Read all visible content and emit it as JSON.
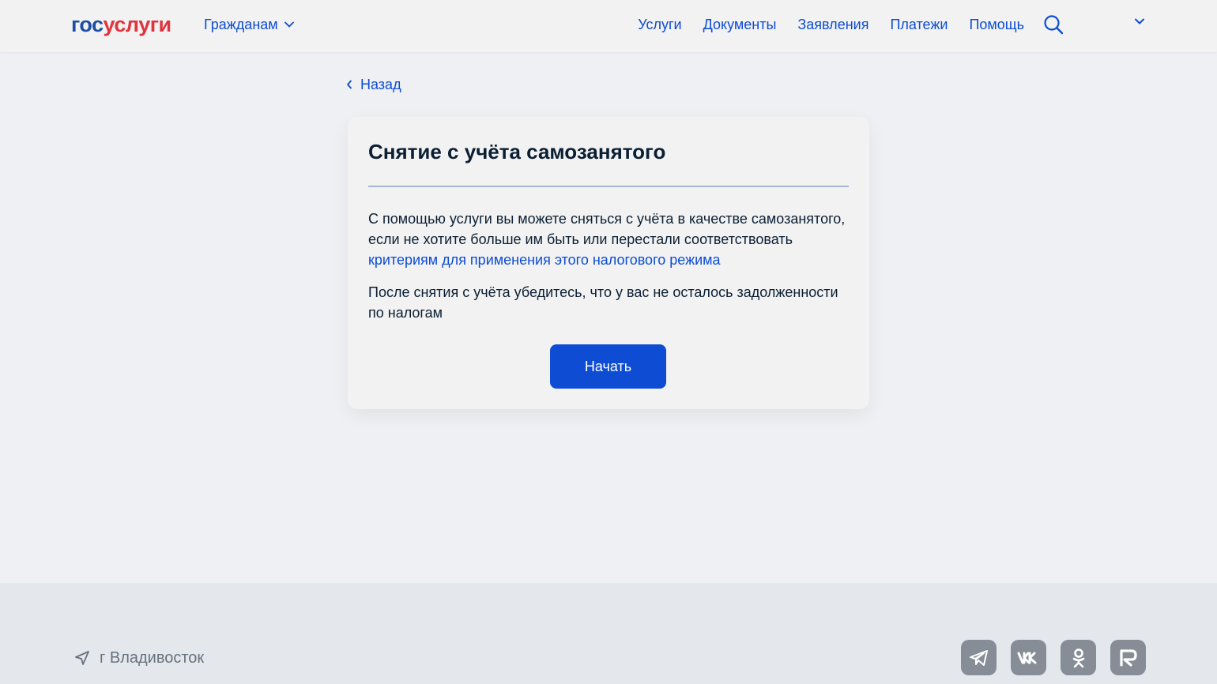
{
  "header": {
    "logo_part1": "гос",
    "logo_part2": "услуги",
    "audience_label": "Гражданам",
    "nav": [
      "Услуги",
      "Документы",
      "Заявления",
      "Платежи",
      "Помощь"
    ]
  },
  "back_label": "Назад",
  "card": {
    "title": "Снятие с учёта самозанятого",
    "text1": "С помощью услуги вы можете сняться с учёта в качестве самозанятого, если не хотите больше им быть или перестали соответствовать ",
    "link": "критериям для применения этого налогового режима",
    "text2": "После снятия с учёта убедитесь, что у вас не осталось задолженности по налогам",
    "start_label": "Начать"
  },
  "footer": {
    "city": "г Владивосток",
    "socials": [
      "telegram-icon",
      "vk-icon",
      "ok-icon",
      "rutube-icon"
    ]
  },
  "colors": {
    "accent": "#0d4cd3",
    "logo_blue": "#1d4ea3",
    "logo_red": "#e0343f"
  }
}
